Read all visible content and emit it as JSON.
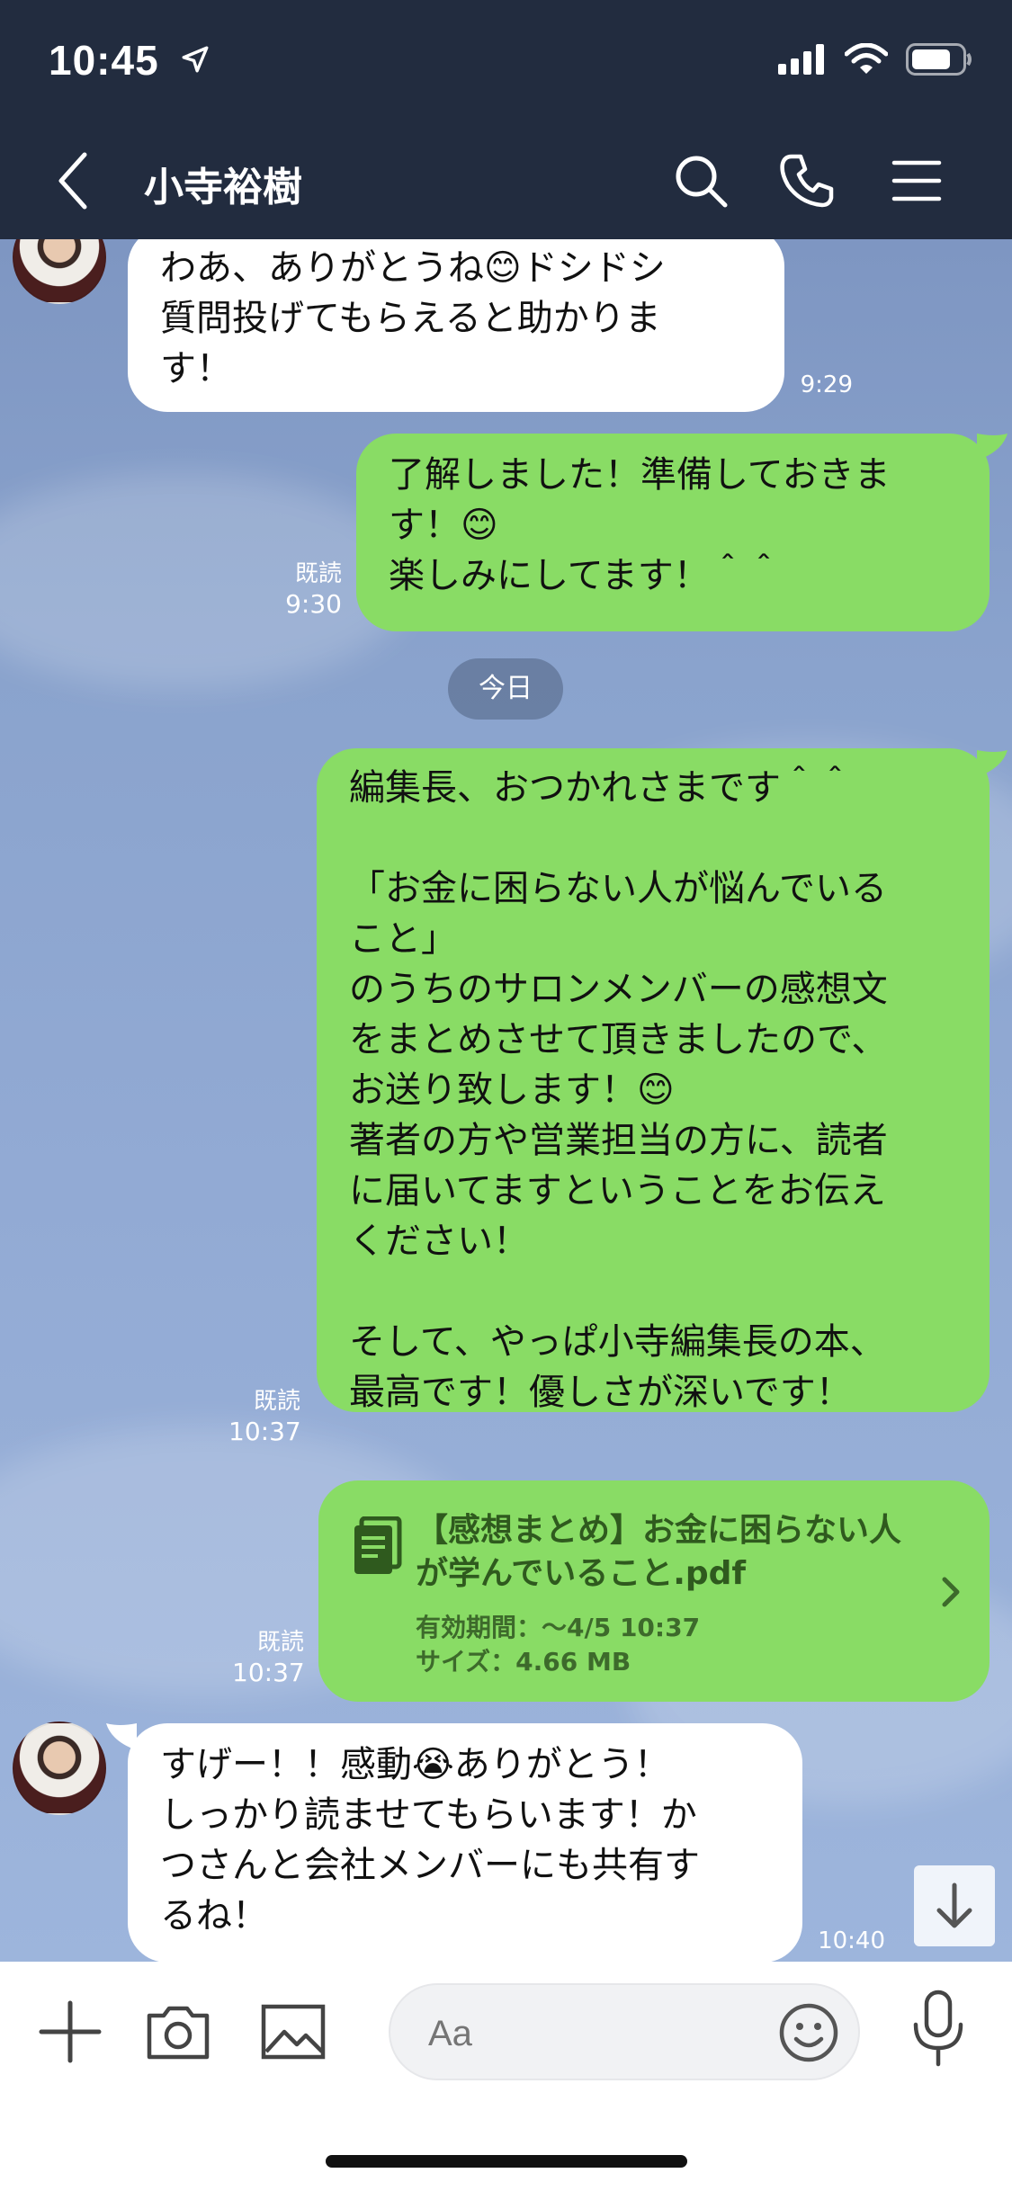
{
  "status": {
    "time": "10:45"
  },
  "header": {
    "title": "小寺裕樹"
  },
  "messages": [
    {
      "text": "わあ、ありがとうね😊ドシドシ\n質問投げてもらえると助かりま\nす！",
      "time": "9:29"
    },
    {
      "text": "了解しました！準備しておきま\nす！😊\n楽しみにしてます！＾＾",
      "read": "既読",
      "time": "9:30"
    },
    {
      "text": "編集長、おつかれさまです＾＾\n\n「お金に困らない人が悩んでいる\nこと」\nのうちのサロンメンバーの感想文\nをまとめさせて頂きましたので、\nお送り致します！😊\n著者の方や営業担当の方に、読者\nに届いてますということをお伝え\nください！\n\nそして、やっぱ小寺編集長の本、\n最高です！優しさが深いです！",
      "read": "既読",
      "time": "10:37"
    },
    {
      "text": "すげー！！感動😭ありがとう！\nしっかり読ませてもらいます！か\nつさんと会社メンバーにも共有す\nるね！",
      "time": "10:40"
    }
  ],
  "date_separator": "今日",
  "file": {
    "title": "【感想まとめ】お金に困らない人が学んでいること.pdf",
    "expiry": "有効期間：〜4/5 10:37",
    "size": "サイズ：4.66 MB",
    "read": "既読",
    "time": "10:37"
  },
  "input": {
    "placeholder": "Aa"
  },
  "colors": {
    "header_bg": "#222c3f",
    "outgoing_bubble": "#89dc65",
    "incoming_bubble": "#ffffff"
  },
  "icons": [
    "back-icon",
    "search-icon",
    "phone-icon",
    "menu-icon",
    "plus-icon",
    "camera-icon",
    "image-icon",
    "emoji-icon",
    "mic-icon",
    "file-icon",
    "chevron-right-icon",
    "arrow-down-icon"
  ]
}
